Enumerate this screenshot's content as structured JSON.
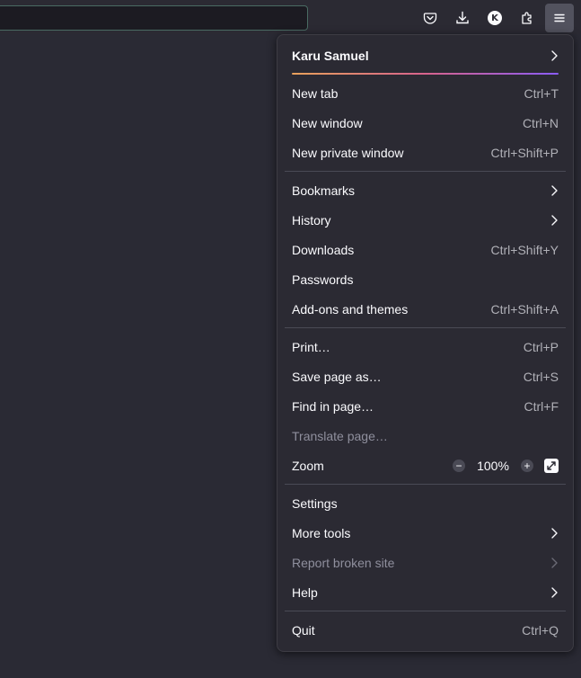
{
  "toolbar": {
    "icons": [
      "pocket-icon",
      "download-icon",
      "account-avatar-icon",
      "extensions-icon",
      "hamburger-menu-icon"
    ],
    "avatar_letter": "K"
  },
  "menu": {
    "account_name": "Karu Samuel",
    "sections": [
      [
        {
          "label": "New tab",
          "shortcut": "Ctrl+T"
        },
        {
          "label": "New window",
          "shortcut": "Ctrl+N"
        },
        {
          "label": "New private window",
          "shortcut": "Ctrl+Shift+P"
        }
      ],
      [
        {
          "label": "Bookmarks",
          "submenu": true
        },
        {
          "label": "History",
          "submenu": true
        },
        {
          "label": "Downloads",
          "shortcut": "Ctrl+Shift+Y"
        },
        {
          "label": "Passwords"
        },
        {
          "label": "Add-ons and themes",
          "shortcut": "Ctrl+Shift+A"
        }
      ],
      [
        {
          "label": "Print…",
          "shortcut": "Ctrl+P"
        },
        {
          "label": "Save page as…",
          "shortcut": "Ctrl+S"
        },
        {
          "label": "Find in page…",
          "shortcut": "Ctrl+F"
        },
        {
          "label": "Translate page…",
          "disabled": true
        }
      ],
      [
        {
          "label": "Settings"
        },
        {
          "label": "More tools",
          "submenu": true
        },
        {
          "label": "Report broken site",
          "submenu": true,
          "disabled": true
        },
        {
          "label": "Help",
          "submenu": true
        }
      ],
      [
        {
          "label": "Quit",
          "shortcut": "Ctrl+Q"
        }
      ]
    ],
    "zoom": {
      "label": "Zoom",
      "value": "100%",
      "minus": "−",
      "plus": "+"
    }
  },
  "colors": {
    "background": "#2b2a33",
    "menu_bg": "#2b2a33",
    "accent_gradient": [
      "#e8a15b",
      "#d7638d",
      "#8a5cf5"
    ]
  }
}
